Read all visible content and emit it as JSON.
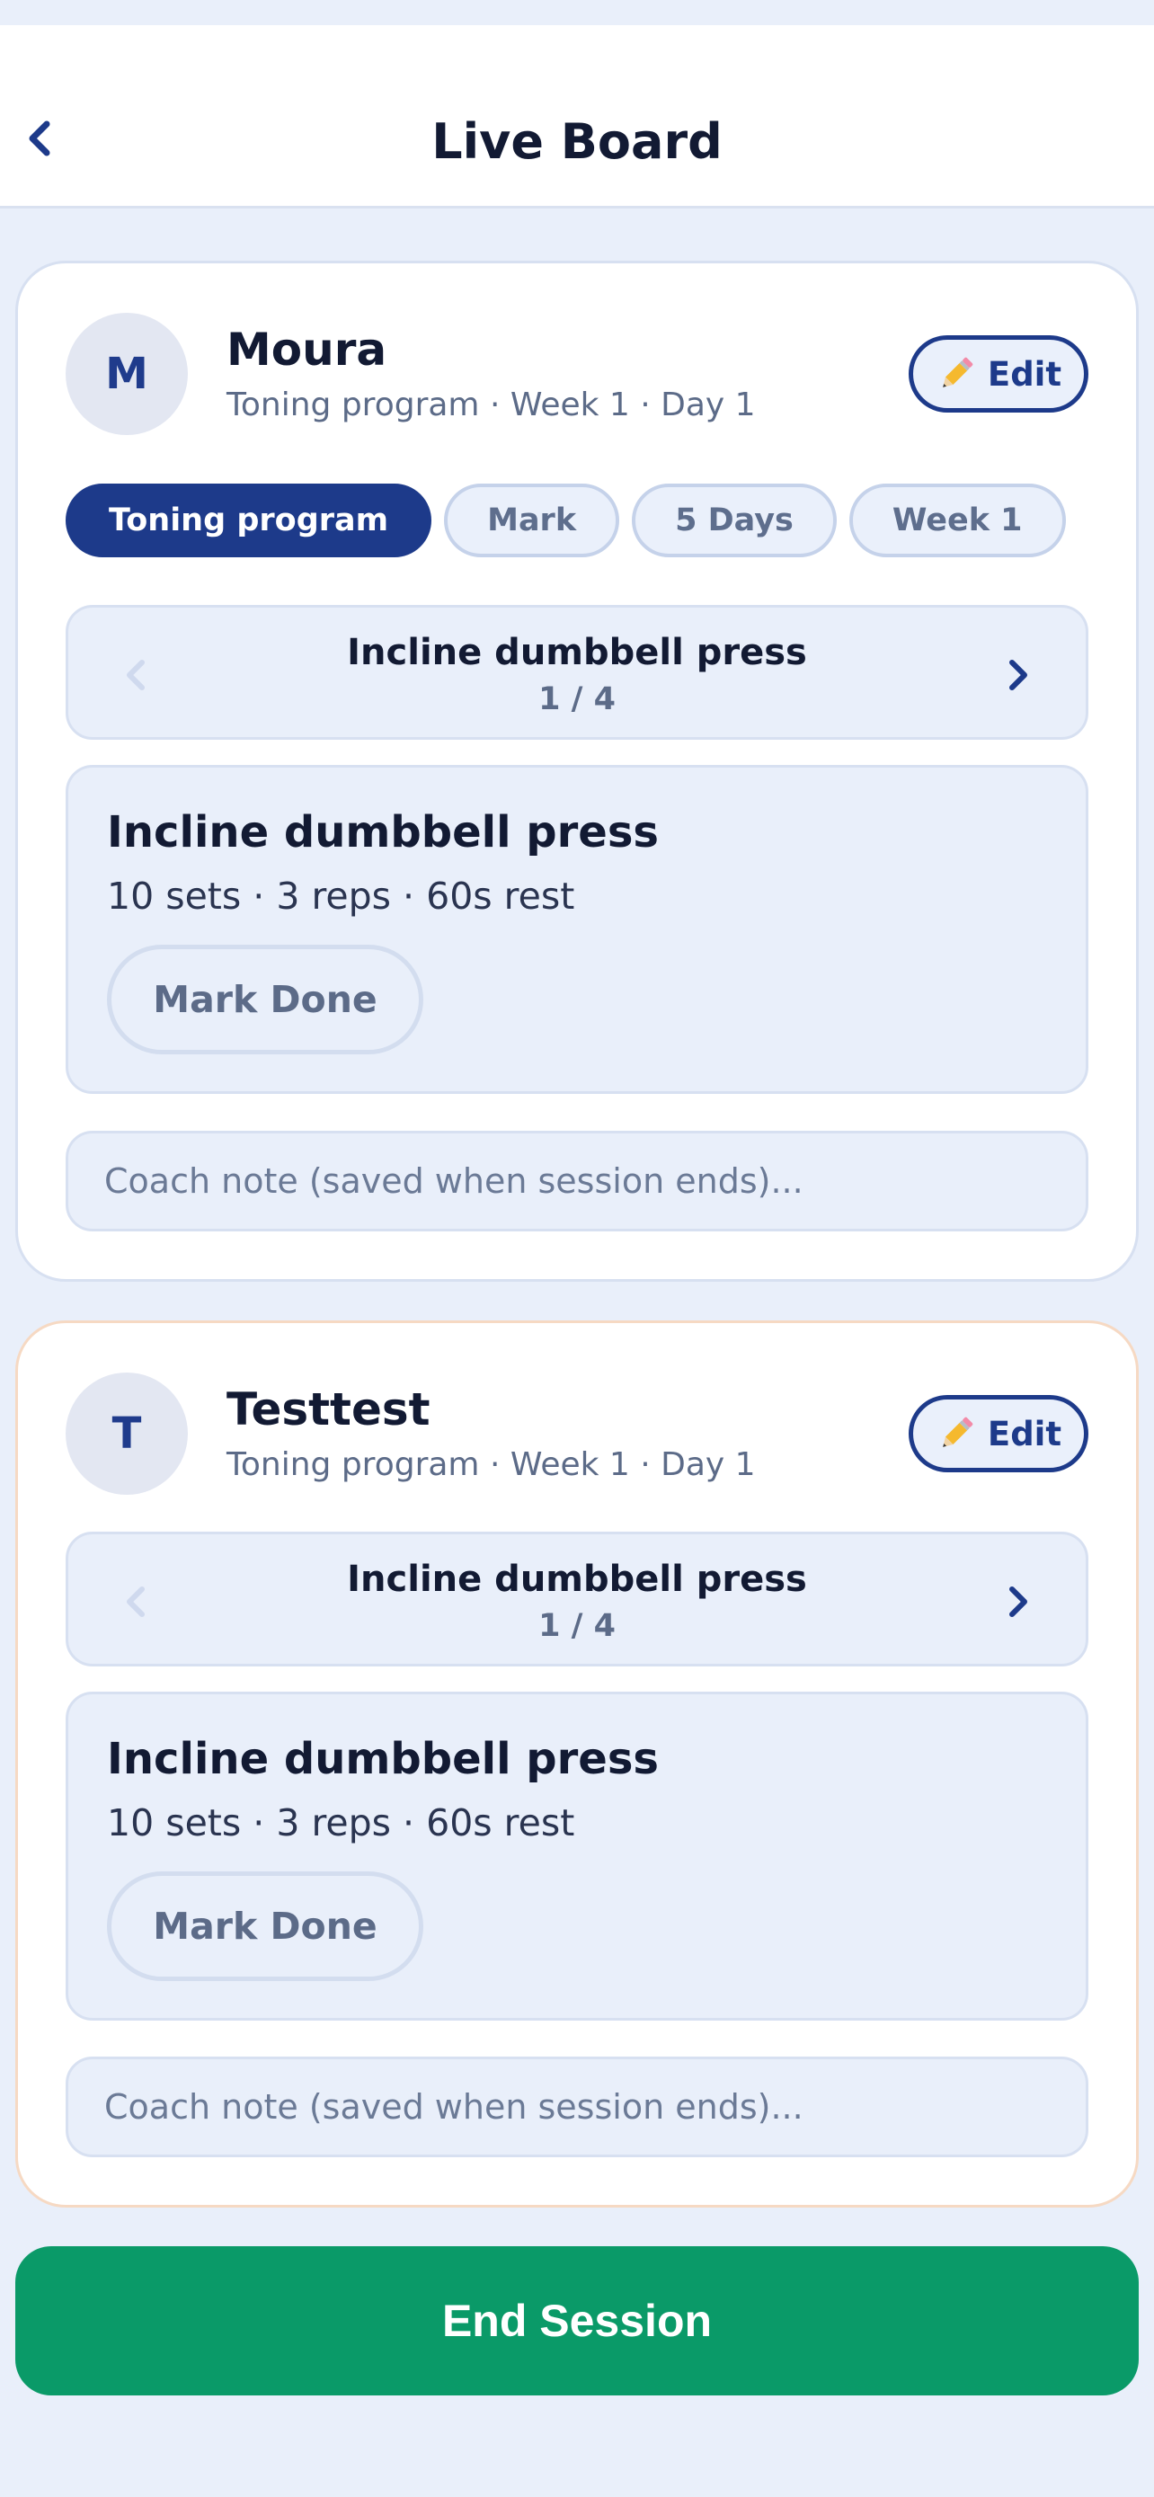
{
  "header": {
    "title": "Live Board",
    "back_icon": "chevron-left-icon"
  },
  "colors": {
    "primary": "#1d3a8a",
    "background": "#e9effa",
    "end_session": "#0a9a68",
    "secondary_card_border": "#f6d9c3"
  },
  "clients": [
    {
      "initial": "M",
      "name": "Moura",
      "subtitle": "Toning program · Week 1 · Day 1",
      "edit_label": "Edit",
      "edit_icon": "pencil-icon",
      "chips": [
        {
          "label": "Toning program",
          "active": true
        },
        {
          "label": "Mark",
          "active": false
        },
        {
          "label": "5 Days",
          "active": false
        },
        {
          "label": "Week 1",
          "active": false
        }
      ],
      "exercise_nav": {
        "name": "Incline dumbbell press",
        "position": "1 / 4"
      },
      "exercise": {
        "title": "Incline dumbbell press",
        "meta": "10 sets · 3 reps · 60s rest",
        "mark_done_label": "Mark Done"
      },
      "coach_note_placeholder": "Coach note (saved when session ends)..."
    },
    {
      "initial": "T",
      "name": "Testtest",
      "subtitle": "Toning program · Week 1 · Day 1",
      "edit_label": "Edit",
      "edit_icon": "pencil-icon",
      "exercise_nav": {
        "name": "Incline dumbbell press",
        "position": "1 / 4"
      },
      "exercise": {
        "title": "Incline dumbbell press",
        "meta": "10 sets · 3 reps · 60s rest",
        "mark_done_label": "Mark Done"
      },
      "coach_note_placeholder": "Coach note (saved when session ends)..."
    }
  ],
  "footer": {
    "end_session_label": "End Session"
  }
}
